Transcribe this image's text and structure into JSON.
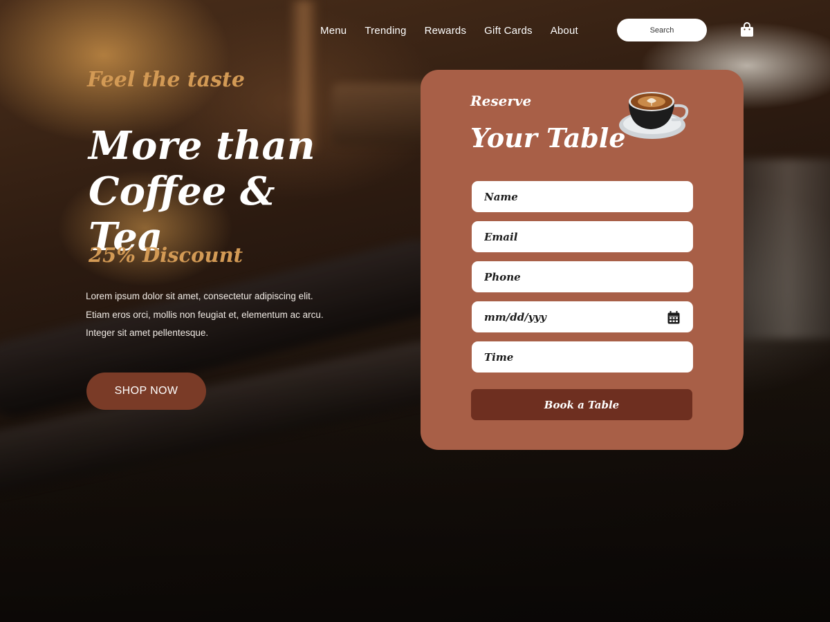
{
  "nav": {
    "items": [
      {
        "label": "Menu"
      },
      {
        "label": "Trending"
      },
      {
        "label": "Rewards"
      },
      {
        "label": "Gift Cards"
      },
      {
        "label": "About"
      }
    ],
    "search_placeholder": "Search",
    "cart_icon": "shopping-bag-icon"
  },
  "hero": {
    "tagline": "Feel the taste",
    "headline_line1": "More than",
    "headline_line2": "Coffee & Tea",
    "discount": "25% Discount",
    "description_line1": "Lorem ipsum dolor sit amet, consectetur adipiscing elit.",
    "description_line2": "Etiam eros orci, mollis non feugiat et, elementum ac arcu.",
    "description_line3": "Integer sit amet pellentesque.",
    "shop_button": "SHOP NOW"
  },
  "reserve": {
    "kicker": "Reserve",
    "title": "Your Table",
    "image_icon": "coffee-cup-icon",
    "fields": {
      "name_placeholder": "Name",
      "email_placeholder": "Email",
      "phone_placeholder": "Phone",
      "date_placeholder": "mm/dd/yyy",
      "time_placeholder": "Time"
    },
    "calendar_icon": "calendar-icon",
    "submit_label": "Book a Table"
  },
  "colors": {
    "accent_gold": "#d39a55",
    "card_bg": "#a85f47",
    "button_dark": "#6e2f20",
    "shop_button_bg": "#7a3b27"
  }
}
